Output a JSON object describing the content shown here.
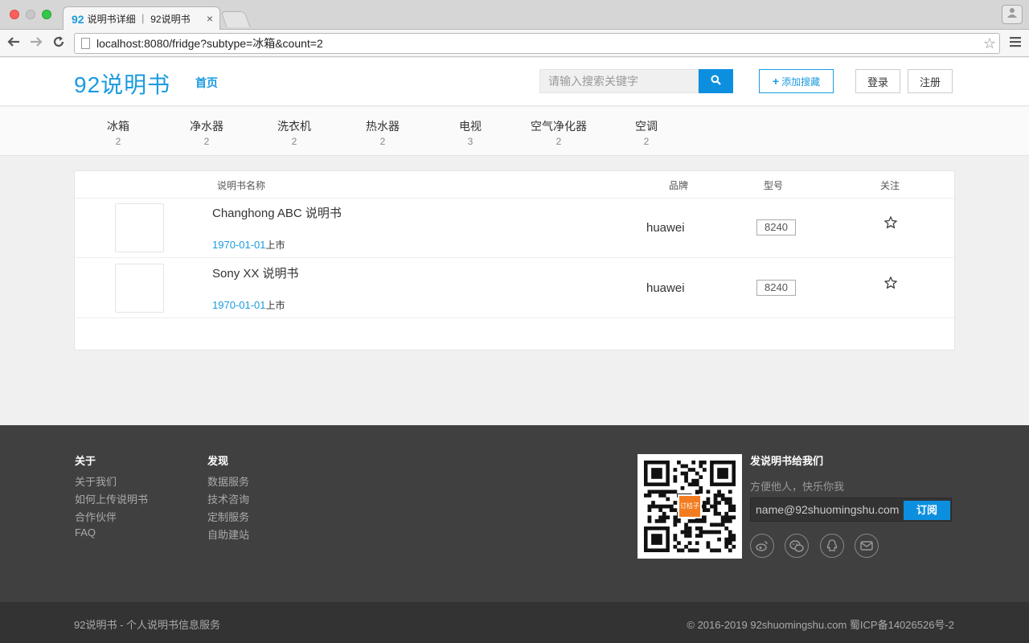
{
  "browser": {
    "tab_favicon": "92",
    "tab_title": "说明书详细 ｜ 92说明书",
    "tab_close": "×",
    "url": "localhost:8080/fridge?subtype=冰箱&count=2"
  },
  "header": {
    "logo": "92说明书",
    "home_link": "首页",
    "search_placeholder": "请输入搜索关键字",
    "add_fav_plus": "+",
    "add_fav_label": "添加搜藏",
    "login": "登录",
    "register": "注册"
  },
  "categories": [
    {
      "name": "冰箱",
      "count": "2"
    },
    {
      "name": "净水器",
      "count": "2"
    },
    {
      "name": "洗衣机",
      "count": "2"
    },
    {
      "name": "热水器",
      "count": "2"
    },
    {
      "name": "电视",
      "count": "3"
    },
    {
      "name": "空气净化器",
      "count": "2"
    },
    {
      "name": "空调",
      "count": "2"
    }
  ],
  "table": {
    "headers": {
      "name": "说明书名称",
      "brand": "品牌",
      "model": "型号",
      "follow": "关注"
    },
    "rows": [
      {
        "name": "Changhong ABC 说明书",
        "date": "1970-01-01",
        "date_suffix": "上市",
        "brand": "huawei",
        "model": "8240"
      },
      {
        "name": "Sony XX 说明书",
        "date": "1970-01-01",
        "date_suffix": "上市",
        "brand": "huawei",
        "model": "8240"
      }
    ]
  },
  "footer": {
    "about_title": "关于",
    "about_links": [
      "关于我们",
      "如何上传说明书",
      "合作伙伴",
      "FAQ"
    ],
    "discover_title": "发现",
    "discover_links": [
      "数据服务",
      "技术咨询",
      "定制服务",
      "自助建站"
    ],
    "qr_logo": "订桔子",
    "send_title": "发说明书给我们",
    "send_subtitle": "方便他人，快乐你我",
    "email_placeholder": "name@92shuomingshu.com",
    "subscribe": "订阅",
    "social_icons": [
      "weibo-icon",
      "wechat-icon",
      "qq-icon",
      "mail-icon"
    ],
    "bottom_left": "92说明书 - 个人说明书信息服务",
    "bottom_right": "© 2016-2019 92shuomingshu.com 蜀ICP备14026526号-2"
  },
  "colors": {
    "accent": "#1a9be0",
    "button_blue": "#0d8fe0",
    "footer_bg": "#404040",
    "footer_bottom_bg": "#333333"
  }
}
